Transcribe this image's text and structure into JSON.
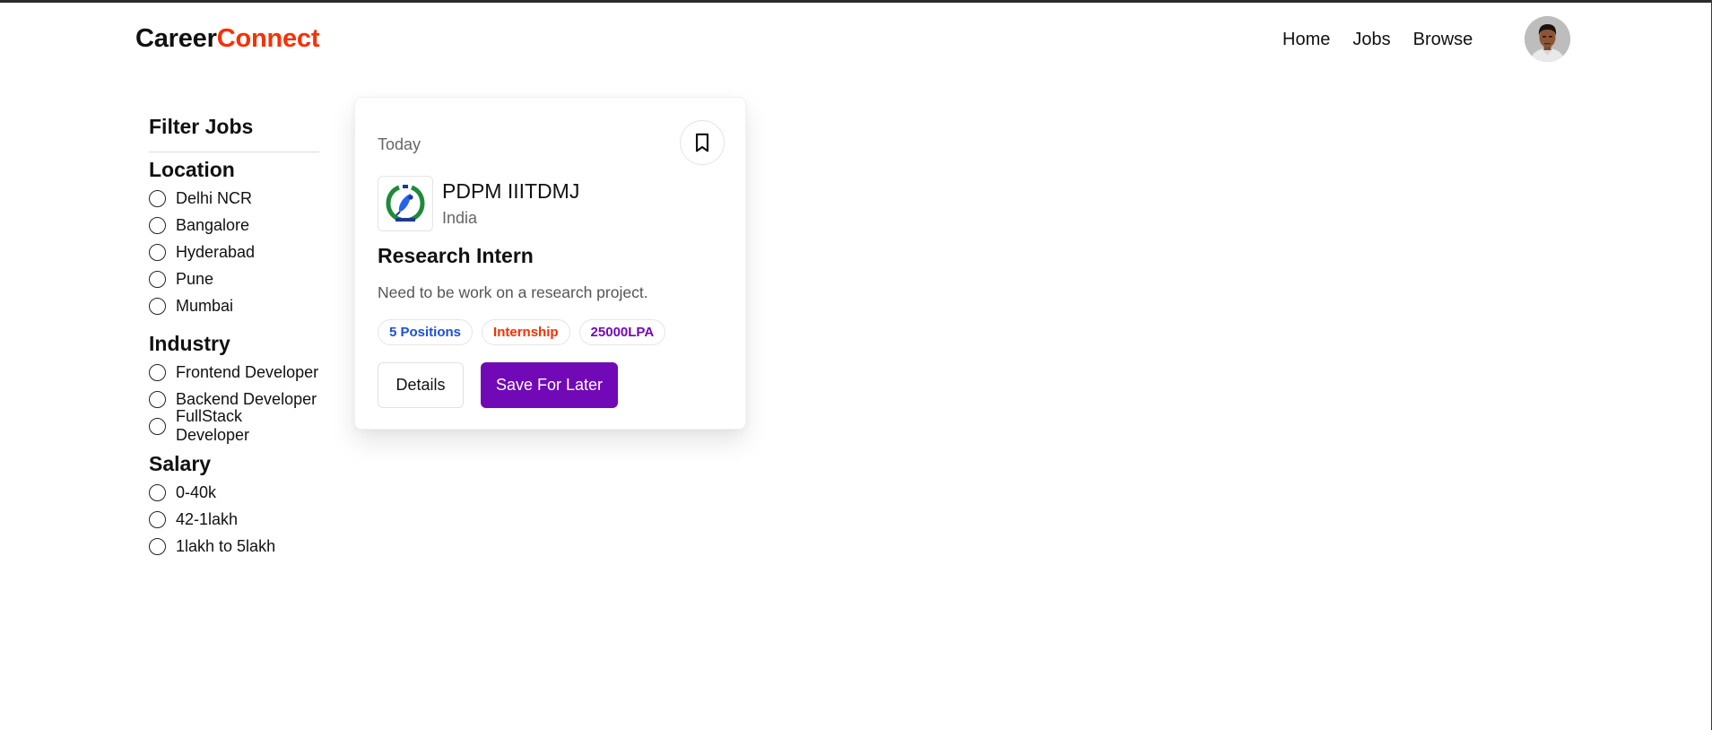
{
  "navbar": {
    "logo_part1": "Career",
    "logo_part2": "Connect",
    "links": [
      "Home",
      "Jobs",
      "Browse"
    ]
  },
  "sidebar": {
    "title": "Filter Jobs",
    "groups": [
      {
        "title": "Location",
        "options": [
          "Delhi NCR",
          "Bangalore",
          "Hyderabad",
          "Pune",
          "Mumbai"
        ]
      },
      {
        "title": "Industry",
        "options": [
          "Frontend Developer",
          "Backend Developer",
          "FullStack Developer"
        ]
      },
      {
        "title": "Salary",
        "options": [
          "0-40k",
          "42-1lakh",
          "1lakh to 5lakh"
        ]
      }
    ]
  },
  "job_card": {
    "posted": "Today",
    "company": "PDPM IIITDMJ",
    "country": "India",
    "title": "Research Intern",
    "description": "Need to be work on a research project.",
    "badges": [
      {
        "label": "5 Positions",
        "color": "#1d4ed8"
      },
      {
        "label": "Internship",
        "color": "#f83002"
      },
      {
        "label": "25000LPA",
        "color": "#7209b7"
      }
    ],
    "details_label": "Details",
    "save_label": "Save For Later"
  },
  "colors": {
    "brand_accent": "#f83002",
    "primary_button": "#7209b7",
    "positions_badge": "#1d4ed8"
  },
  "icons": {
    "bookmark": "bookmark-icon",
    "company_logo": "company-logo-icon",
    "avatar": "user-avatar"
  }
}
